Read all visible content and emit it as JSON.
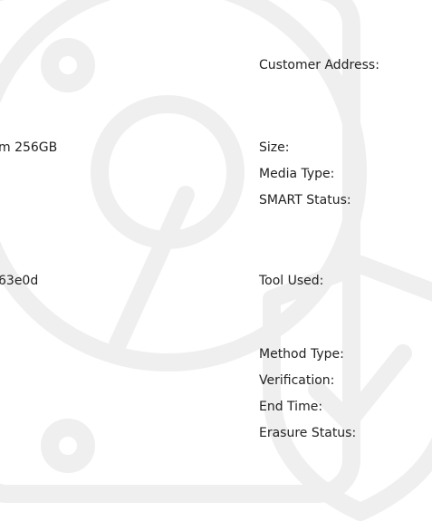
{
  "report": {
    "left_values": {
      "model": "m 256GB",
      "serial": "63e0d"
    },
    "right_labels": {
      "customer_address": "Customer Address:",
      "size": "Size:",
      "media_type": "Media Type:",
      "smart_status": "SMART Status:",
      "tool_used": "Tool Used:",
      "method_type": "Method Type:",
      "verification": "Verification:",
      "end_time": "End Time:",
      "erasure_status": "Erasure Status:"
    }
  },
  "watermark": {
    "icon": "hard-drive-shield-icon",
    "color": "#efefef"
  }
}
